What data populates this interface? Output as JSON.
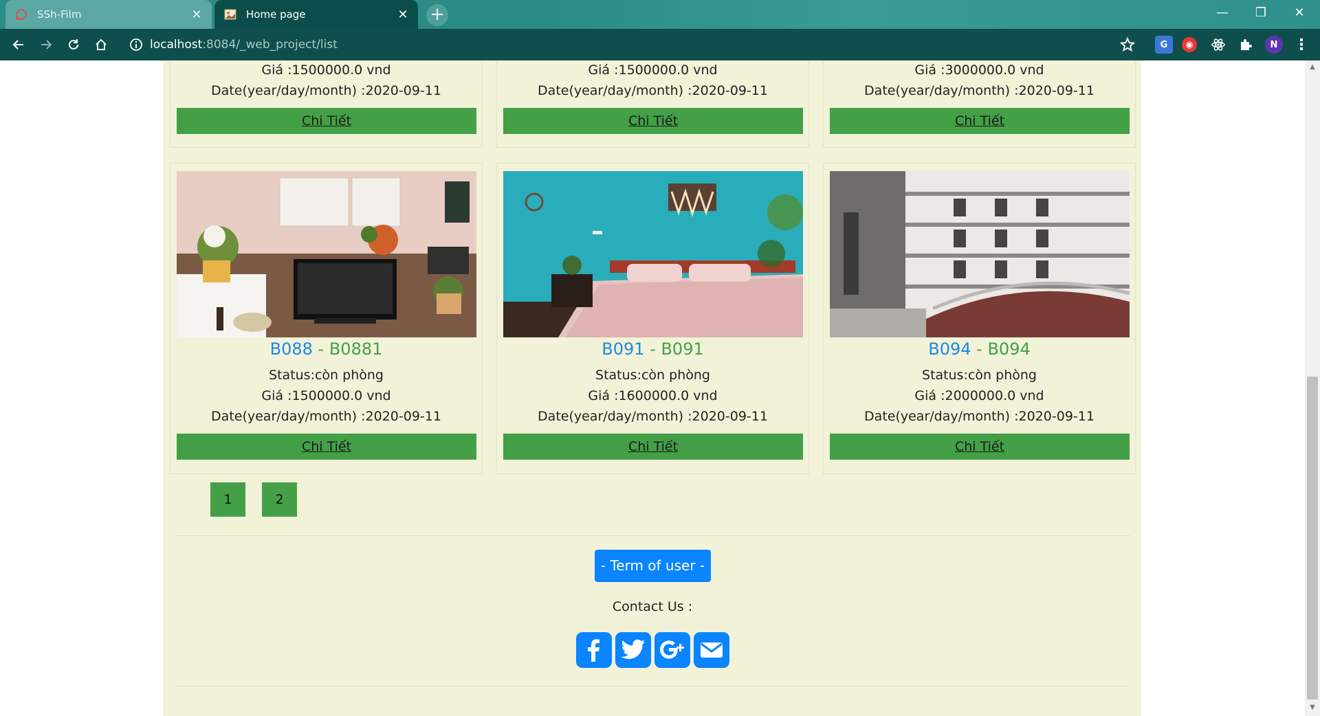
{
  "browser": {
    "tabs": [
      {
        "title": "SSh-Film",
        "active": false
      },
      {
        "title": "Home page",
        "active": true
      }
    ],
    "url_host": "localhost",
    "url_path": ":8084/_web_project/list",
    "avatar_letter": "N"
  },
  "top_cards": [
    {
      "price": "Giá :1500000.0 vnd",
      "date": "Date(year/day/month) :2020-09-11",
      "button": "Chi Tiết"
    },
    {
      "price": "Giá :1500000.0 vnd",
      "date": "Date(year/day/month) :2020-09-11",
      "button": "Chi Tiết"
    },
    {
      "price": "Giá :3000000.0 vnd",
      "date": "Date(year/day/month) :2020-09-11",
      "button": "Chi Tiết"
    }
  ],
  "cards": [
    {
      "code": "B088",
      "separator": " - ",
      "name": "B0881",
      "status": "Status:còn phòng",
      "price": "Giá :1500000.0 vnd",
      "date": "Date(year/day/month) :2020-09-11",
      "button": "Chi Tiết"
    },
    {
      "code": "B091",
      "separator": " - ",
      "name": "B091",
      "status": "Status:còn phòng",
      "price": "Giá :1600000.0 vnd",
      "date": "Date(year/day/month) :2020-09-11",
      "button": "Chi Tiết"
    },
    {
      "code": "B094",
      "separator": " - ",
      "name": "B094",
      "status": "Status:còn phòng",
      "price": "Giá :2000000.0 vnd",
      "date": "Date(year/day/month) :2020-09-11",
      "button": "Chi Tiết"
    }
  ],
  "pagination": [
    "1",
    "2"
  ],
  "footer": {
    "term_button": "- Term of user -",
    "contact": "Contact Us :"
  },
  "colors": {
    "page_bg": "#f2f2d9",
    "button_green": "#43a047",
    "link_blue": "#1e88e5",
    "primary_blue": "#0a84ff"
  }
}
